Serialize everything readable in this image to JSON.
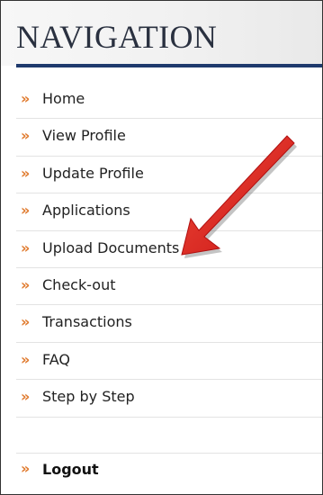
{
  "navigation": {
    "title": "NAVIGATION",
    "items": [
      {
        "label": "Home"
      },
      {
        "label": "View Profile"
      },
      {
        "label": "Update Profile"
      },
      {
        "label": "Applications"
      },
      {
        "label": "Upload Documents"
      },
      {
        "label": "Check-out"
      },
      {
        "label": "Transactions"
      },
      {
        "label": "FAQ"
      },
      {
        "label": "Step by Step"
      }
    ],
    "logout": {
      "label": "Logout"
    },
    "bullet": "»"
  },
  "annotation": {
    "icon": "red-arrow-icon",
    "color": "#e01e1e",
    "points_to": "Upload Documents"
  },
  "colors": {
    "accent_bullet": "#e07b2f",
    "header_rule": "#1f3a6d",
    "title_text": "#2a3140"
  }
}
